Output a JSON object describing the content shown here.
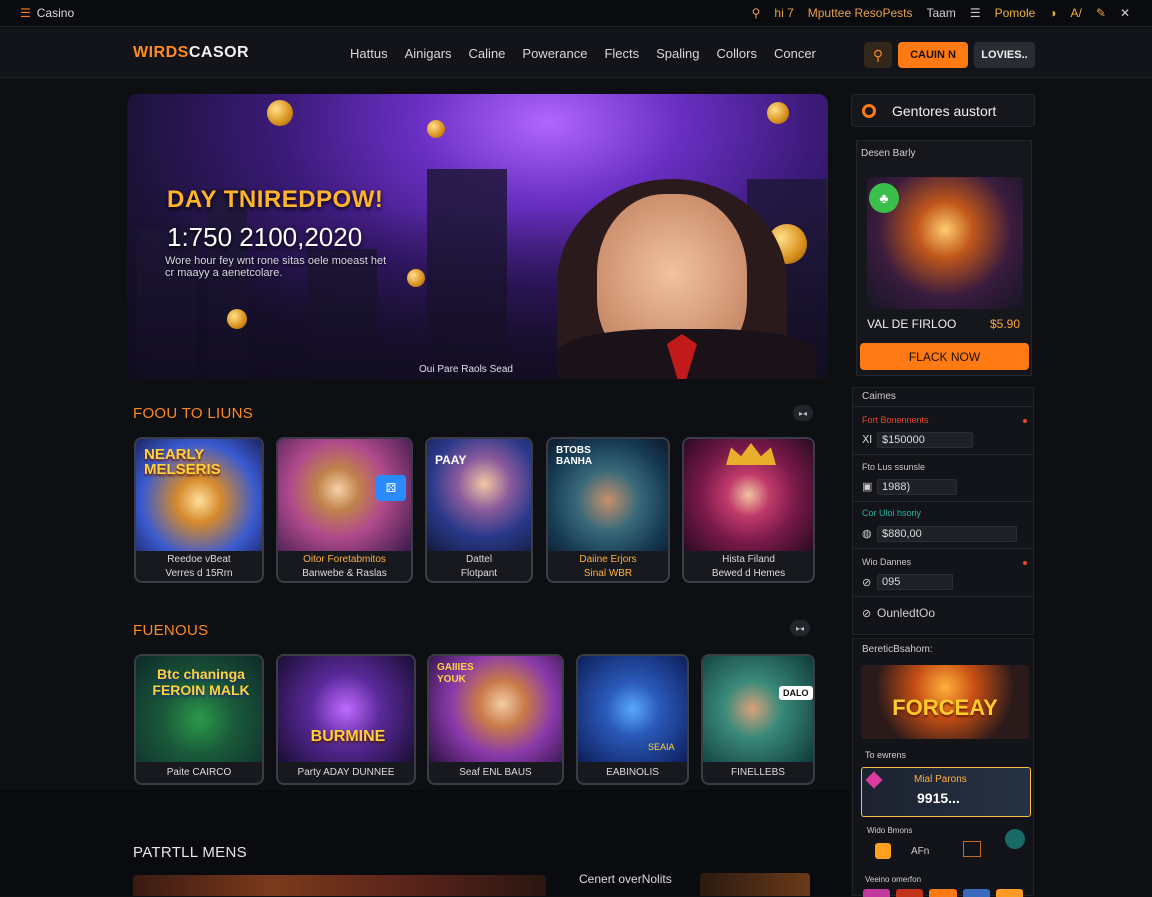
{
  "topbar": {
    "menu_icon": "hamburger-icon",
    "site_label": "Casino",
    "items": [
      "hi 7",
      "Mputtee ResoPests",
      "Taam"
    ],
    "list_icon": "list-icon",
    "account_label": "Pomole",
    "extra": "A/"
  },
  "nav": {
    "logo": "WIRDSCASOR",
    "menu": [
      "Hattus",
      "Ainigars",
      "Caline",
      "Powerance",
      "Flects",
      "Spaling",
      "Collors",
      "Concer"
    ],
    "login": "CAUIN N",
    "register": "LOVIES..",
    "accent": "#ff7a12"
  },
  "hero": {
    "title": "DAY TNIREDPOW!",
    "amount": "1:750 2100,2020",
    "subtitle": "Wore hour fey wnt rone sitas oele moeast het cr maayy a aenetcolare.",
    "caption": "Oui Pare Raols Sead"
  },
  "section1": {
    "title": "FOOU TO LIUNS",
    "games": [
      {
        "art_text": "NEARLY MELSERIS",
        "line1": "Reedoe vBeat",
        "line2": "Verres d 15Rrn",
        "art": "treasure"
      },
      {
        "art_text": "",
        "line1": "Oitor Foretabmitos",
        "line2": "Banwebe & Raslas",
        "art": "blonde",
        "orange": true
      },
      {
        "art_text": "PAAY",
        "line1": "Dattel",
        "line2": "Flotpant",
        "art": "fantasy"
      },
      {
        "art_text": "BTOBS BANHA",
        "line1": "Daiine Erjors",
        "line2": "Sinal WBR",
        "art": "man",
        "orange": true
      },
      {
        "art_text": "",
        "line1": "Hista Filand",
        "line2": "Bewed d Hemes",
        "art": "queen"
      }
    ]
  },
  "section2": {
    "title": "FUENOUS",
    "games": [
      {
        "art_text": "Btc chaninga FEROIN MALK",
        "line": "Paite CAIRCO",
        "art": "green"
      },
      {
        "art_text": "BURMINE",
        "line": "Party ADAY DUNNEE",
        "art": "purple"
      },
      {
        "art_text": "GAIIIES YOUK",
        "line": "Seaf ENL BAUS",
        "art": "blonde2"
      },
      {
        "art_text": "SEAIA",
        "line": "EABINOLIS",
        "art": "blue"
      },
      {
        "art_text": "DALO",
        "line": "FINELLEBS",
        "art": "teal"
      }
    ]
  },
  "section3": {
    "title": "PATRTLL MENS",
    "right_label": "Cenert overNolits"
  },
  "sidebar": {
    "header": "Gentores austort",
    "box_label": "Desen Barly",
    "value_label": "VAL DE FIRLOO",
    "value_price": "$5.90",
    "play": "FLACK NOW",
    "form": {
      "title": "Caimes",
      "fields": [
        {
          "label": "Fort Bonennents",
          "value": "$150000",
          "icon": "A",
          "red": true
        },
        {
          "label": "Fto Lus ssunsle",
          "value": "1988)",
          "icon": "B"
        },
        {
          "label": "Cor Uloi hsoriy",
          "value": "$880,00",
          "icon": "C",
          "teal": true
        },
        {
          "label": "Wio Dannes",
          "value": "095",
          "icon": "D"
        }
      ],
      "bottom": "OunledtOo"
    },
    "promo": {
      "title": "BereticBsahom:",
      "art_text": "FORCEAY",
      "label2": "To ewrens",
      "art2_title": "Mial Parons",
      "art2_value": "9915...",
      "label3": "Wido Bmons",
      "bottom_text": "AFn",
      "label4": "Veeino omerfon"
    }
  }
}
